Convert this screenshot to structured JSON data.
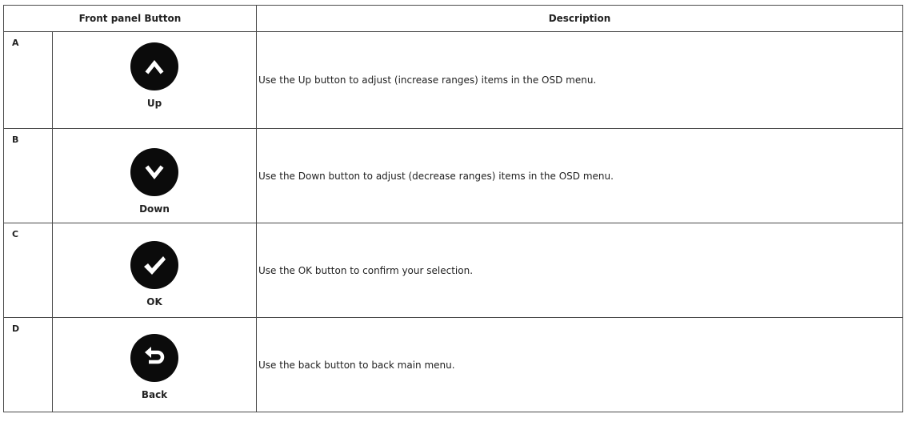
{
  "table": {
    "headers": {
      "button_col": "Front panel Button",
      "desc_col": "Description"
    },
    "rows": [
      {
        "letter": "A",
        "icon": "up-arrow-icon",
        "label": "Up",
        "description": "Use the Up button to adjust (increase ranges) items in the OSD menu."
      },
      {
        "letter": "B",
        "icon": "down-arrow-icon",
        "label": "Down",
        "description": "Use the Down button to adjust (decrease ranges) items in the OSD menu."
      },
      {
        "letter": "C",
        "icon": "checkmark-icon",
        "label": "OK",
        "description": "Use the OK button to confirm your selection."
      },
      {
        "letter": "D",
        "icon": "back-arrow-icon",
        "label": "Back",
        "description": "Use the back button to back main menu."
      }
    ]
  },
  "colors": {
    "button_fill": "#0b0b0b",
    "icon_fill": "#ffffff",
    "border": "#4a4a4a",
    "text": "#222222"
  }
}
